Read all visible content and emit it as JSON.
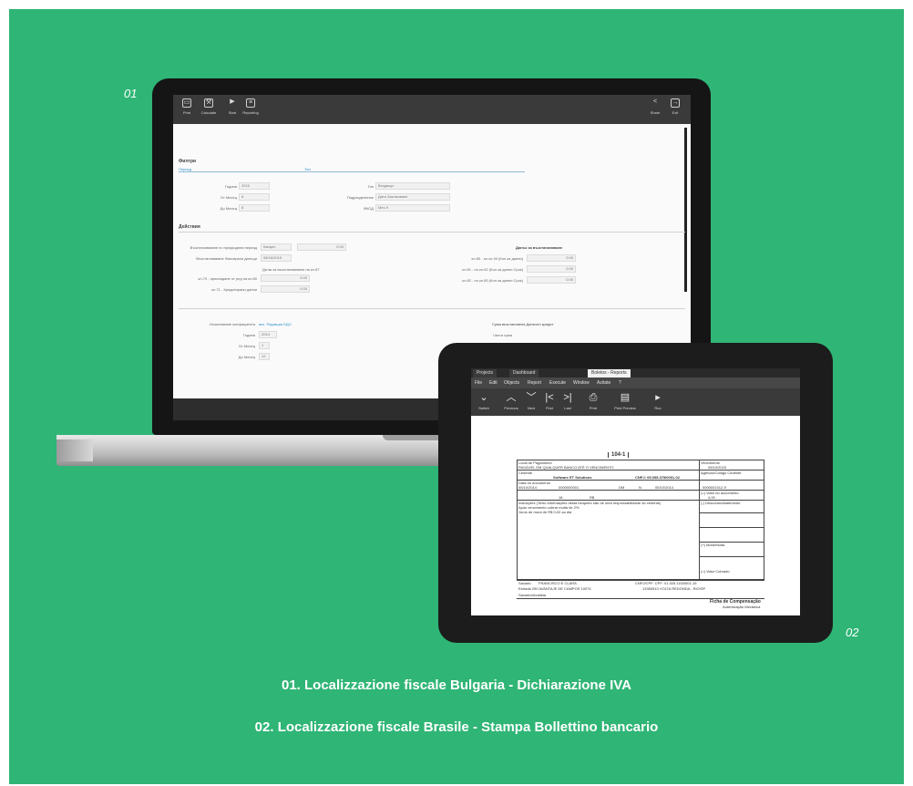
{
  "labels": {
    "one": "01",
    "two": "02"
  },
  "captions": {
    "line1": "01. Localizzazione fiscale Bulgaria - Dichiarazione IVA",
    "line2": "02. Localizzazione fiscale Brasile -  Stampa Bollettino bancario"
  },
  "colors": {
    "background": "#2fb575",
    "device": "#151515"
  },
  "laptop": {
    "toolbar": [
      {
        "icon": "print-icon",
        "label": "Print"
      },
      {
        "icon": "wrench-icon",
        "label": "Calculate"
      },
      {
        "icon": "play-icon",
        "label": "Start"
      },
      {
        "icon": "report-icon",
        "label": "Reporting"
      }
    ],
    "toolbar_right": [
      {
        "icon": "share-icon",
        "label": "Share"
      },
      {
        "icon": "exit-icon",
        "label": "Exit"
      }
    ],
    "filters_title": "Филтри",
    "tabs": [
      "Период",
      "Тип"
    ],
    "fields_left": [
      {
        "label": "Година",
        "value": "2015"
      },
      {
        "label": "От Месец",
        "value": "8"
      },
      {
        "label": "До Месец",
        "value": "8"
      }
    ],
    "fields_right": [
      {
        "label": "Тип",
        "value": "Входящи"
      },
      {
        "label": "Подразделение",
        "value": "Дата Заключване"
      },
      {
        "label": "ФКОД",
        "value": "Мес.9"
      }
    ],
    "actions_title": "Действия",
    "action_rows": [
      {
        "label": "Възстановяване по предходния период",
        "value": "Канцел",
        "amount": "0.00"
      },
      {
        "label": "Възстановяване Фиксирани данъци",
        "value": "06/18/2015"
      },
      {
        "label": "кл.70 - приспадане от ред на кл.80",
        "amount": "0.00"
      },
      {
        "label": "кл.71 - Кредитирани данни",
        "amount": "0.00"
      }
    ],
    "deductions_note": "Дълж.за възстановяване на кл.87",
    "right_title": "Данък за възстановяване",
    "right_rows": [
      {
        "label": "кл.80 - по кл.40 (Кол.за данни)",
        "value": "0.00"
      },
      {
        "label": "кл.81 - по кл.82 (Кол.за данни Срок)",
        "value": "0.00"
      },
      {
        "label": "кл.82 - по кл.80 (Кол.за данни Срок)",
        "value": "0.00"
      }
    ],
    "bottom_left": [
      {
        "label": "Изчисляване коефициента",
        "value": "вкл. Редакция ЕДО"
      },
      {
        "label": "Година",
        "value": "2014"
      },
      {
        "label": "От Месец",
        "value": "1"
      },
      {
        "label": "До Месец",
        "value": "12"
      }
    ],
    "bottom_right_title": "Сума възстановена Данъчен кредит",
    "bottom_right_row": {
      "label": "Чиста сума",
      "value": "0.00"
    }
  },
  "tablet": {
    "title_tabs": [
      "Projects",
      "Dashboard",
      "Boletos - Reports"
    ],
    "menu": [
      "File",
      "Edit",
      "Objects",
      "Report",
      "Execute",
      "Window",
      "Azitate",
      "?"
    ],
    "tools": [
      {
        "icon": "switch-icon",
        "label": "Switch"
      },
      {
        "icon": "previous-icon",
        "label": "Previous"
      },
      {
        "icon": "next-icon",
        "label": "Next"
      },
      {
        "icon": "first-icon",
        "label": "First"
      },
      {
        "icon": "last-icon",
        "label": "Last"
      },
      {
        "icon": "print-icon",
        "label": "Print"
      },
      {
        "icon": "print-preview-icon",
        "label": "Print Preview"
      },
      {
        "icon": "play-icon",
        "label": "Run"
      }
    ],
    "doc": {
      "bank_code": "104-1",
      "local_label": "Local de Pagamento",
      "local_value": "PAGÁVEL EM QUALQUER BANCO ATÉ O VENCIMENTO",
      "vencimento_label": "Vencimento",
      "vencimento_value": "05/10/2015",
      "cedente_label": "Cedente",
      "cedente_value": "Software ET Solutions",
      "cnpj_value": "CNPJ: 05.055.375/0001-02",
      "agencia_label": "Agência/Código Cedente",
      "data_doc_label": "Data do documento",
      "data_doc_value": "05/10/2014",
      "num_doc_value": "0000000001",
      "especie_value": "DM",
      "aceite_value": "N",
      "data_proc_value": "05/10/2014",
      "nosso_num_value": "0000001012-9",
      "carteira_value": "18",
      "moeda_value": "R$",
      "valor_label": "(=) Valor do documento",
      "valor_value": "4,00",
      "instrucoes": "Instruções (Texto informações desta bloqueto são de uma responsabilidade do cedente)",
      "instr_line1": "Após vencimento cobrar multa de 2%",
      "instr_line2": "Juros de mora de R$ 0,02 ao dia",
      "desconto_label": "(-) Desconto/Abatimento",
      "mora_label": "(+) Mora/Multa",
      "cobrado_label": "(=) Valor Cobrado",
      "sacado_label": "Sacado",
      "sacado_value": "FRANCISCO E CLARA",
      "endereco": "Estrada 250 AVANTAJE DE CAMPOS 10074",
      "cpf_value": "CNPJ/CPF: CPF: 01.025.115/0001-15",
      "cep_value": "13350510 VOLTA REDONDA - RIO/SP",
      "sacador_label": "Sacador/Avalista",
      "ficha": "Ficha de Compensação",
      "ficha_sub": "Autenticação Mecânica"
    }
  }
}
